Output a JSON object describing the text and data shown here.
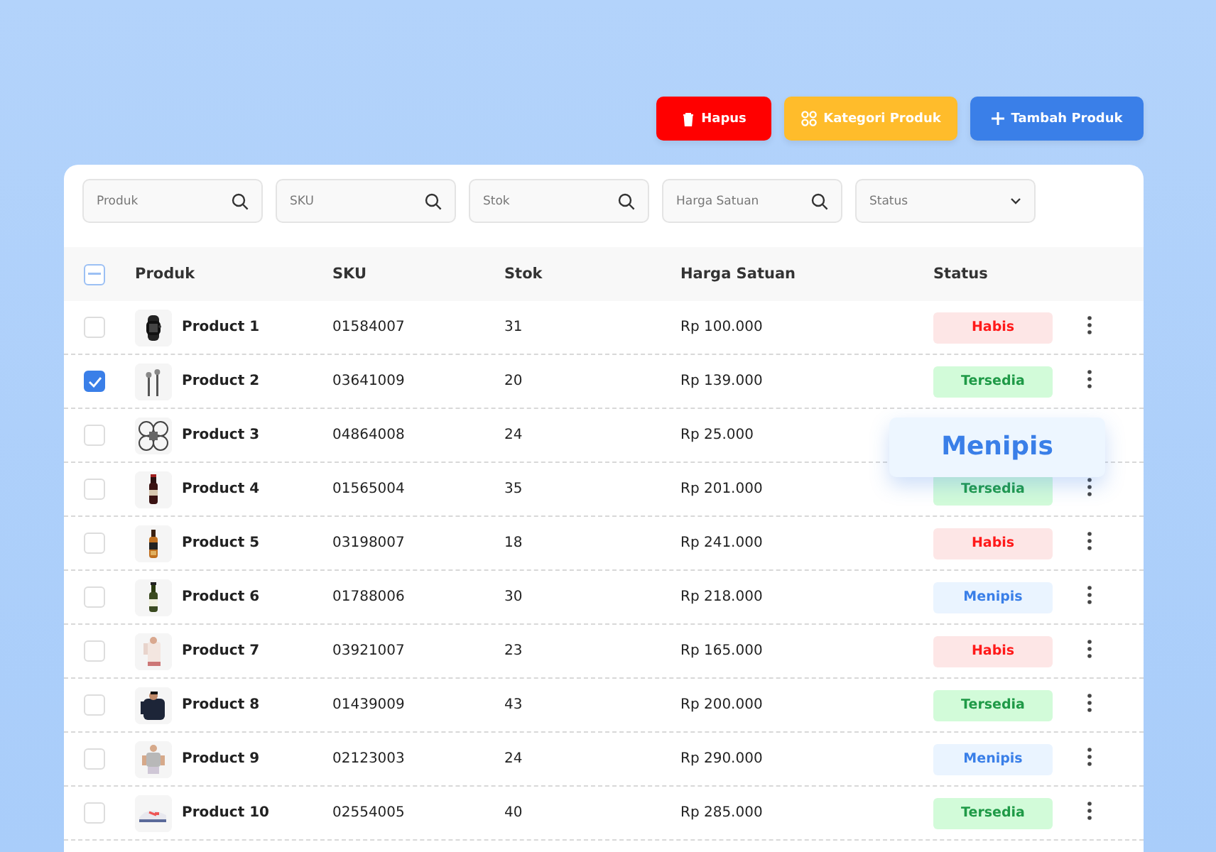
{
  "actions": [
    {
      "label": "Hapus",
      "kind": "delete"
    },
    {
      "label": "Kategori Produk",
      "kind": "category"
    },
    {
      "label": "Tambah Produk",
      "kind": "add"
    }
  ],
  "filters": [
    {
      "placeholder": "Produk",
      "kind": "search"
    },
    {
      "placeholder": "SKU",
      "kind": "search"
    },
    {
      "placeholder": "Stok",
      "kind": "search"
    },
    {
      "placeholder": "Harga Satuan",
      "kind": "search"
    },
    {
      "placeholder": "Status",
      "kind": "select"
    }
  ],
  "table": {
    "select_all": {
      "indeterminate": true
    },
    "columns": [
      "Produk",
      "SKU",
      "Stok",
      "Harga Satuan",
      "Status"
    ],
    "rows": [
      {
        "checked": false,
        "name": "Product 1",
        "sku": "01584007",
        "stock": "31",
        "price": "Rp 100.000",
        "status": {
          "label": "Habis",
          "kind": "out"
        },
        "popped": false
      },
      {
        "checked": true,
        "name": "Product 2",
        "sku": "03641009",
        "stock": "20",
        "price": "Rp 139.000",
        "status": {
          "label": "Tersedia",
          "kind": "available"
        },
        "popped": false
      },
      {
        "checked": false,
        "name": "Product 3",
        "sku": "04864008",
        "stock": "24",
        "price": "Rp 25.000",
        "status": {
          "label": "Menipis",
          "kind": "low"
        },
        "popped": true
      },
      {
        "checked": false,
        "name": "Product 4",
        "sku": "01565004",
        "stock": "35",
        "price": "Rp 201.000",
        "status": {
          "label": "Tersedia",
          "kind": "available"
        },
        "popped": false
      },
      {
        "checked": false,
        "name": "Product 5",
        "sku": "03198007",
        "stock": "18",
        "price": "Rp 241.000",
        "status": {
          "label": "Habis",
          "kind": "out"
        },
        "popped": false
      },
      {
        "checked": false,
        "name": "Product 6",
        "sku": "01788006",
        "stock": "30",
        "price": "Rp 218.000",
        "status": {
          "label": "Menipis",
          "kind": "low"
        },
        "popped": false
      },
      {
        "checked": false,
        "name": "Product 7",
        "sku": "03921007",
        "stock": "23",
        "price": "Rp 165.000",
        "status": {
          "label": "Habis",
          "kind": "out"
        },
        "popped": false
      },
      {
        "checked": false,
        "name": "Product 8",
        "sku": "01439009",
        "stock": "43",
        "price": "Rp 200.000",
        "status": {
          "label": "Tersedia",
          "kind": "available"
        },
        "popped": false
      },
      {
        "checked": false,
        "name": "Product 9",
        "sku": "02123003",
        "stock": "24",
        "price": "Rp 290.000",
        "status": {
          "label": "Menipis",
          "kind": "low"
        },
        "popped": false
      },
      {
        "checked": false,
        "name": "Product 10",
        "sku": "02554005",
        "stock": "40",
        "price": "Rp 285.000",
        "status": {
          "label": "Tersedia",
          "kind": "available"
        },
        "popped": false
      }
    ]
  }
}
